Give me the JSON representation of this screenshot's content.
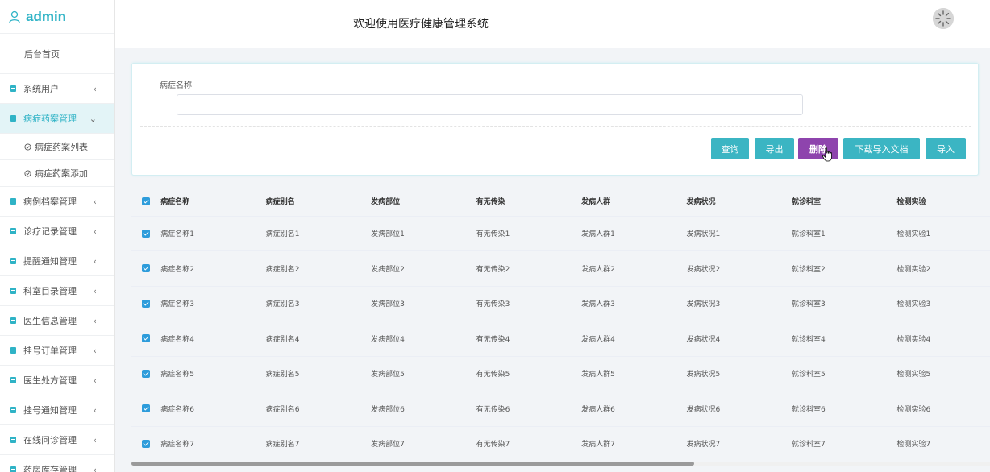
{
  "sidebar": {
    "brand": "admin",
    "home": "后台首页",
    "items": [
      {
        "label": "系统用户",
        "arrow": "‹"
      },
      {
        "label": "病症药案管理",
        "arrow": "⌄"
      },
      {
        "label": "病例档案管理",
        "arrow": "‹"
      },
      {
        "label": "诊疗记录管理",
        "arrow": "‹"
      },
      {
        "label": "提醒通知管理",
        "arrow": "‹"
      },
      {
        "label": "科室目录管理",
        "arrow": "‹"
      },
      {
        "label": "医生信息管理",
        "arrow": "‹"
      },
      {
        "label": "挂号订单管理",
        "arrow": "‹"
      },
      {
        "label": "医生处方管理",
        "arrow": "‹"
      },
      {
        "label": "挂号通知管理",
        "arrow": "‹"
      },
      {
        "label": "在线问诊管理",
        "arrow": "‹"
      },
      {
        "label": "药房库存管理",
        "arrow": "‹"
      }
    ],
    "subitems": [
      {
        "label": "病症药案列表"
      },
      {
        "label": "病症药案添加"
      }
    ]
  },
  "header": {
    "title": "欢迎使用医疗健康管理系统"
  },
  "search": {
    "label": "病症名称",
    "value": "",
    "buttons": {
      "query": "查询",
      "export": "导出",
      "delete": "删除",
      "download_template": "下载导入文档",
      "import": "导入"
    }
  },
  "table": {
    "headers": [
      "病症名称",
      "病症别名",
      "发病部位",
      "有无传染",
      "发病人群",
      "发病状况",
      "就诊科室",
      "检测实验"
    ],
    "rows": [
      [
        "病症名称1",
        "病症别名1",
        "发病部位1",
        "有无传染1",
        "发病人群1",
        "发病状况1",
        "就诊科室1",
        "检测实验1"
      ],
      [
        "病症名称2",
        "病症别名2",
        "发病部位2",
        "有无传染2",
        "发病人群2",
        "发病状况2",
        "就诊科室2",
        "检测实验2"
      ],
      [
        "病症名称3",
        "病症别名3",
        "发病部位3",
        "有无传染3",
        "发病人群3",
        "发病状况3",
        "就诊科室3",
        "检测实验3"
      ],
      [
        "病症名称4",
        "病症别名4",
        "发病部位4",
        "有无传染4",
        "发病人群4",
        "发病状况4",
        "就诊科室4",
        "检测实验4"
      ],
      [
        "病症名称5",
        "病症别名5",
        "发病部位5",
        "有无传染5",
        "发病人群5",
        "发病状况5",
        "就诊科室5",
        "检测实验5"
      ],
      [
        "病症名称6",
        "病症别名6",
        "发病部位6",
        "有无传染6",
        "发病人群6",
        "发病状况6",
        "就诊科室6",
        "检测实验6"
      ],
      [
        "病症名称7",
        "病症别名7",
        "发病部位7",
        "有无传染7",
        "发病人群7",
        "发病状况7",
        "就诊科室7",
        "检测实验7"
      ]
    ]
  },
  "colors": {
    "accent": "#2fb3c6",
    "button": "#3bb5c3",
    "delete": "#8e44ad",
    "checkbox": "#2d9cdb"
  },
  "icons": {
    "brand": "user-icon",
    "menu": "document-icon",
    "sub": "check-circle-icon",
    "avatar": "avatar-icon"
  }
}
